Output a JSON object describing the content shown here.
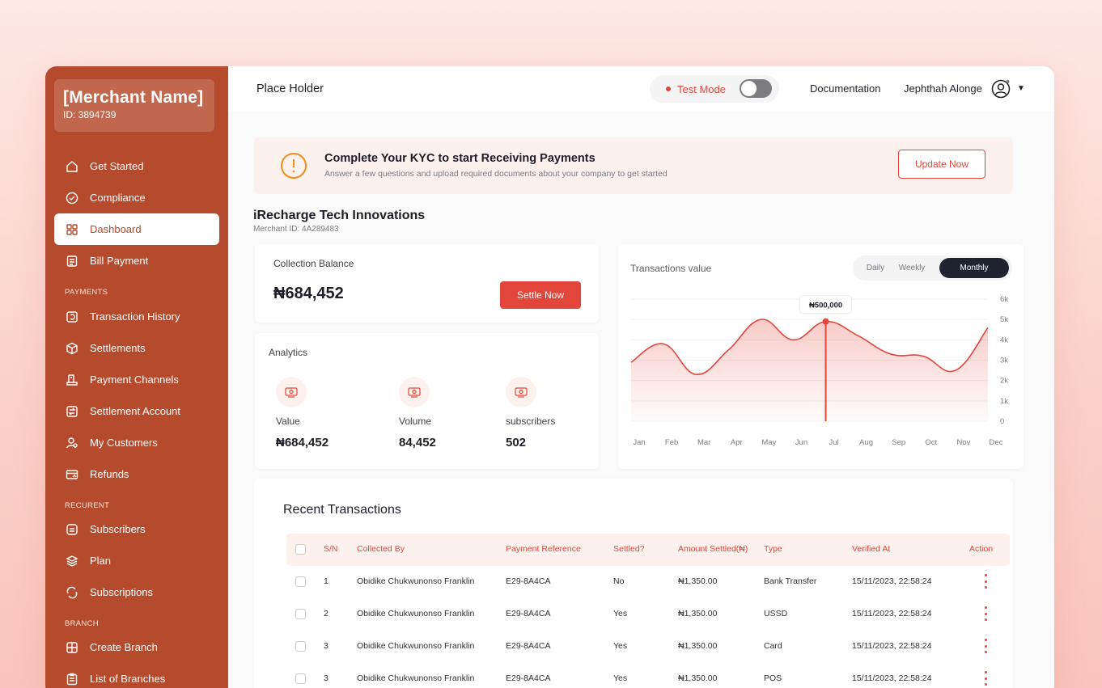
{
  "sidebar": {
    "merchant_name": "[Merchant Name]",
    "merchant_id": "ID: 3894739",
    "items": [
      {
        "label": "Get Started",
        "icon": "home-icon"
      },
      {
        "label": "Compliance",
        "icon": "check-circle-icon"
      },
      {
        "label": "Dashboard",
        "icon": "grid-icon",
        "active": true
      },
      {
        "label": "Bill Payment",
        "icon": "document-icon"
      },
      {
        "label": "Transaction History",
        "icon": "history-icon"
      },
      {
        "label": "Settlements",
        "icon": "box-icon"
      },
      {
        "label": "Payment Channels",
        "icon": "bank-icon"
      },
      {
        "label": "Settlement Account",
        "icon": "transfer-icon"
      },
      {
        "label": "My Customers",
        "icon": "users-icon"
      },
      {
        "label": "Refunds",
        "icon": "card-icon"
      },
      {
        "label": "Subscribers",
        "icon": "subscriber-icon"
      },
      {
        "label": "Plan",
        "icon": "layers-icon"
      },
      {
        "label": "Subscriptions",
        "icon": "repeat-icon"
      },
      {
        "label": "Create Branch",
        "icon": "building-icon"
      },
      {
        "label": "List of Branches",
        "icon": "clipboard-icon"
      }
    ],
    "sections": {
      "payments": "PAYMENTS",
      "recurent": "RECURENT",
      "branch": "BRANCH"
    }
  },
  "header": {
    "title": "Place Holder",
    "mode_label": "Test Mode",
    "test_mode_on": false,
    "documentation": "Documentation",
    "user_name": "Jephthah Alonge"
  },
  "kyc": {
    "title": "Complete Your KYC to start Receiving Payments",
    "subtitle": "Answer a few questions and upload required documents about your company to get started",
    "button": "Update Now"
  },
  "company": {
    "name": "iRecharge Tech Innovations",
    "merchant_id": "Merchant ID: 4A289483"
  },
  "balance": {
    "label": "Collection Balance",
    "value": "₦684,452",
    "button": "Settle Now"
  },
  "analytics": {
    "title": "Analytics",
    "metrics": [
      {
        "label": "Value",
        "value": "₦684,452"
      },
      {
        "label": "Volume",
        "value": "84,452"
      },
      {
        "label": "subscribers",
        "value": "502"
      }
    ]
  },
  "chart": {
    "title": "Transactions value",
    "tabs": [
      "Daily",
      "Weekly",
      "Monthly"
    ],
    "active_tab": "Monthly",
    "tooltip": "₦500,000",
    "accent": "#e2463a"
  },
  "chart_data": {
    "type": "area",
    "x": [
      "Jan",
      "Feb",
      "Mar",
      "Apr",
      "May",
      "Jun",
      "Jul",
      "Aug",
      "Sep",
      "Oct",
      "Nov",
      "Dec"
    ],
    "series": [
      {
        "values": [
          2900,
          3800,
          2300,
          3500,
          5000,
          4000,
          4900,
          4200,
          3300,
          3200,
          2500,
          4600
        ]
      }
    ],
    "y_ticks": [
      "0",
      "1k",
      "2k",
      "3k",
      "4k",
      "5k",
      "6k"
    ],
    "ylim": [
      0,
      6000
    ],
    "highlight_index": 6,
    "grid": true
  },
  "transactions": {
    "title": "Recent Transactions",
    "columns": [
      "S/N",
      "Collected By",
      "Payment Reference",
      "Settled?",
      "Amount Settled(₦)",
      "Type",
      "Verified At",
      "Action"
    ],
    "rows": [
      {
        "sn": "1",
        "collected_by": "Obidike Chukwunonso Franklin",
        "ref": "E29-8A4CA",
        "settled": "No",
        "amount": "₦1,350.00",
        "type": "Bank Transfer",
        "verified": "15/11/2023, 22:58:24"
      },
      {
        "sn": "2",
        "collected_by": "Obidike Chukwunonso Franklin",
        "ref": "E29-8A4CA",
        "settled": "Yes",
        "amount": "₦1,350.00",
        "type": "USSD",
        "verified": "15/11/2023, 22:58:24"
      },
      {
        "sn": "3",
        "collected_by": "Obidike Chukwunonso Franklin",
        "ref": "E29-8A4CA",
        "settled": "Yes",
        "amount": "₦1,350.00",
        "type": "Card",
        "verified": "15/11/2023, 22:58:24"
      },
      {
        "sn": "3",
        "collected_by": "Obidike Chukwunonso Franklin",
        "ref": "E29-8A4CA",
        "settled": "Yes",
        "amount": "₦1,350.00",
        "type": "POS",
        "verified": "15/11/2023, 22:58:24"
      }
    ]
  }
}
